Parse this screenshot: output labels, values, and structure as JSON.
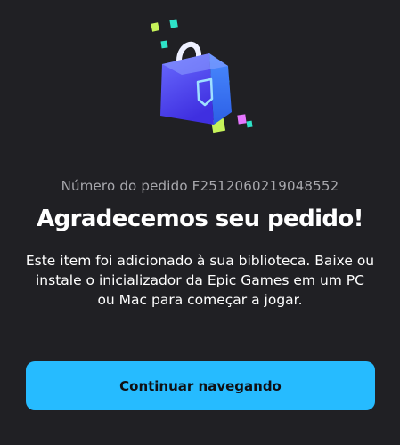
{
  "illustration": {
    "icon": "shopping-bag-icon"
  },
  "order": {
    "number_text": "Número do pedido F2512060219048552"
  },
  "confirmation": {
    "title": "Agradecemos seu pedido!",
    "description": "Este item foi adicionado à sua biblioteca. Baixe ou instale o inicializador da Epic Games em um PC ou Mac para começar a jogar."
  },
  "actions": {
    "continue_label": "Continuar navegando"
  },
  "colors": {
    "background": "#202024",
    "accent": "#26bbff"
  }
}
